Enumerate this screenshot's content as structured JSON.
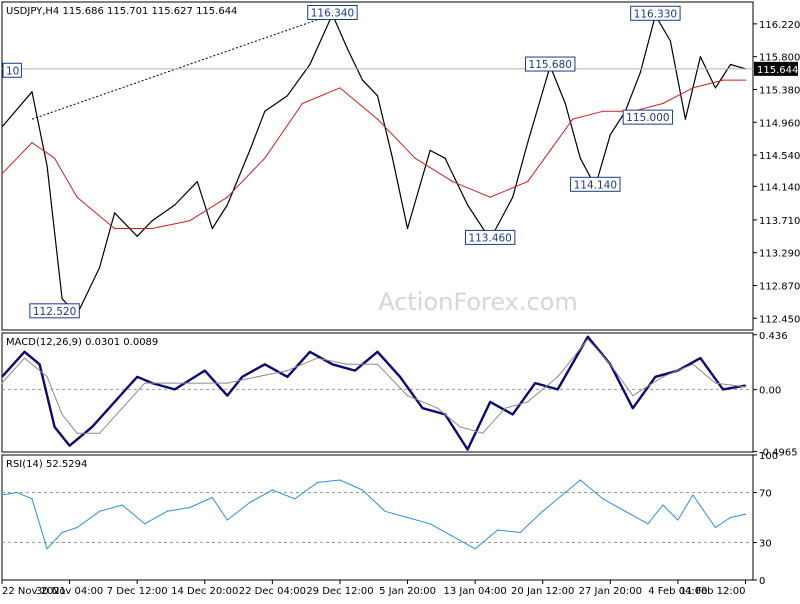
{
  "chart_data": [
    {
      "type": "line",
      "panel": "price",
      "symbol": "USDJPY,H4",
      "header": "USDJPY,H4  115.686 115.701 115.627 115.644",
      "ylim": [
        112.3,
        116.5
      ],
      "y_ticks": [
        116.22,
        115.8,
        115.38,
        114.96,
        114.54,
        114.14,
        113.71,
        113.29,
        112.87,
        112.45
      ],
      "y_tick_labels": [
        "116.220",
        "115.800",
        "115.380",
        "114.960",
        "114.540",
        "114.140",
        "113.710",
        "113.290",
        "112.870",
        "112.450"
      ],
      "current_price_label": "115.644",
      "current_price": 115.644,
      "x_tick_labels": [
        "22 Nov 2021",
        "30 Nov 04:00",
        "7 Dec 12:00",
        "14 Dec 20:00",
        "22 Dec 04:00",
        "29 Dec 12:00",
        "5 Jan 20:00",
        "13 Jan 04:00",
        "20 Jan 12:00",
        "27 Jan 20:00",
        "4 Feb 04:00",
        "11 Feb 12:00"
      ],
      "series": [
        {
          "x": [
            0,
            0.04,
            0.06,
            0.08,
            0.1,
            0.13,
            0.15,
            0.18,
            0.2,
            0.23,
            0.26,
            0.28,
            0.3,
            0.33,
            0.35,
            0.38,
            0.41,
            0.44,
            0.46,
            0.48,
            0.5,
            0.52,
            0.54,
            0.57,
            0.59,
            0.62,
            0.65,
            0.68,
            0.7,
            0.73,
            0.75,
            0.77,
            0.79,
            0.81,
            0.83,
            0.85,
            0.87,
            0.89,
            0.91,
            0.93,
            0.95,
            0.97,
            0.99
          ],
          "values": [
            114.9,
            115.35,
            114.4,
            112.7,
            112.5,
            113.1,
            113.8,
            113.5,
            113.7,
            113.9,
            114.2,
            113.6,
            113.9,
            114.6,
            115.1,
            115.3,
            115.7,
            116.34,
            115.9,
            115.5,
            115.3,
            114.5,
            113.6,
            114.6,
            114.5,
            113.9,
            113.46,
            114.0,
            114.7,
            115.68,
            115.2,
            114.5,
            114.14,
            114.8,
            115.1,
            115.6,
            116.33,
            116.0,
            115.0,
            115.8,
            115.4,
            115.7,
            115.644
          ]
        },
        {
          "x": [
            0,
            0.04,
            0.07,
            0.1,
            0.15,
            0.2,
            0.25,
            0.3,
            0.35,
            0.4,
            0.45,
            0.5,
            0.55,
            0.6,
            0.65,
            0.7,
            0.73,
            0.76,
            0.8,
            0.84,
            0.88,
            0.92,
            0.96,
            0.99
          ],
          "values": [
            114.3,
            114.7,
            114.5,
            114.0,
            113.6,
            113.6,
            113.7,
            114.0,
            114.5,
            115.2,
            115.4,
            115.0,
            114.5,
            114.2,
            114.0,
            114.2,
            114.6,
            115.0,
            115.1,
            115.1,
            115.2,
            115.4,
            115.5,
            115.5
          ]
        }
      ],
      "annotations": [
        {
          "label": "116.340",
          "x": 0.44,
          "value": 116.34
        },
        {
          "label": "116.330",
          "x": 0.87,
          "value": 116.33
        },
        {
          "label": "115.680",
          "x": 0.73,
          "value": 115.68
        },
        {
          "label": "115.000",
          "x": 0.86,
          "value": 115.0
        },
        {
          "label": "114.140",
          "x": 0.79,
          "value": 114.14
        },
        {
          "label": "113.460",
          "x": 0.65,
          "value": 113.46
        },
        {
          "label": "112.520",
          "x": 0.07,
          "value": 112.52
        },
        {
          "label": "10",
          "x": 0.0,
          "value": 115.6
        }
      ],
      "watermark": "ActionForex.com"
    },
    {
      "type": "line",
      "panel": "macd",
      "header": "MACD(12,26,9) 0.0301 0.0089",
      "ylim": [
        -0.5,
        0.45
      ],
      "y_ticks": [
        0.436,
        0.0,
        -0.4965
      ],
      "y_tick_labels": [
        "0.436",
        "0.00",
        "-0.4965"
      ],
      "series": [
        {
          "x": [
            0,
            0.03,
            0.05,
            0.07,
            0.09,
            0.12,
            0.15,
            0.18,
            0.2,
            0.23,
            0.27,
            0.3,
            0.32,
            0.35,
            0.38,
            0.41,
            0.44,
            0.47,
            0.5,
            0.53,
            0.56,
            0.59,
            0.62,
            0.65,
            0.68,
            0.71,
            0.74,
            0.78,
            0.81,
            0.84,
            0.87,
            0.9,
            0.93,
            0.96,
            0.99
          ],
          "values": [
            0.1,
            0.3,
            0.2,
            -0.3,
            -0.45,
            -0.3,
            -0.1,
            0.1,
            0.05,
            0.0,
            0.15,
            -0.05,
            0.1,
            0.2,
            0.1,
            0.3,
            0.2,
            0.15,
            0.3,
            0.1,
            -0.15,
            -0.2,
            -0.48,
            -0.1,
            -0.2,
            0.05,
            0.0,
            0.42,
            0.2,
            -0.15,
            0.1,
            0.15,
            0.25,
            0.0,
            0.03
          ]
        },
        {
          "x": [
            0,
            0.03,
            0.06,
            0.08,
            0.1,
            0.13,
            0.16,
            0.19,
            0.22,
            0.25,
            0.3,
            0.34,
            0.38,
            0.42,
            0.46,
            0.5,
            0.54,
            0.58,
            0.61,
            0.64,
            0.67,
            0.7,
            0.74,
            0.78,
            0.81,
            0.84,
            0.88,
            0.92,
            0.95,
            0.99
          ],
          "values": [
            0.05,
            0.25,
            0.1,
            -0.2,
            -0.35,
            -0.35,
            -0.15,
            0.05,
            0.05,
            0.05,
            0.05,
            0.1,
            0.15,
            0.25,
            0.2,
            0.2,
            -0.05,
            -0.15,
            -0.3,
            -0.35,
            -0.15,
            -0.1,
            0.1,
            0.4,
            0.2,
            -0.05,
            0.1,
            0.2,
            0.05,
            0.02
          ]
        }
      ]
    },
    {
      "type": "line",
      "panel": "rsi",
      "header": "RSI(14) 52.5294",
      "ylim": [
        0,
        100
      ],
      "y_ticks": [
        100,
        70,
        30,
        0
      ],
      "y_tick_labels": [
        "100",
        "70",
        "30",
        "0"
      ],
      "reference_lines": [
        70,
        30
      ],
      "series": [
        {
          "x": [
            0,
            0.02,
            0.04,
            0.06,
            0.08,
            0.1,
            0.13,
            0.16,
            0.19,
            0.22,
            0.25,
            0.28,
            0.3,
            0.33,
            0.36,
            0.39,
            0.42,
            0.45,
            0.48,
            0.51,
            0.54,
            0.57,
            0.6,
            0.63,
            0.66,
            0.69,
            0.72,
            0.75,
            0.77,
            0.8,
            0.83,
            0.86,
            0.88,
            0.9,
            0.92,
            0.95,
            0.97,
            0.99
          ],
          "values": [
            68,
            70,
            65,
            25,
            38,
            42,
            55,
            60,
            45,
            55,
            58,
            66,
            48,
            62,
            72,
            65,
            78,
            80,
            72,
            55,
            50,
            45,
            35,
            25,
            40,
            38,
            55,
            70,
            80,
            65,
            55,
            45,
            60,
            48,
            68,
            42,
            50,
            52.5294
          ]
        }
      ]
    }
  ]
}
